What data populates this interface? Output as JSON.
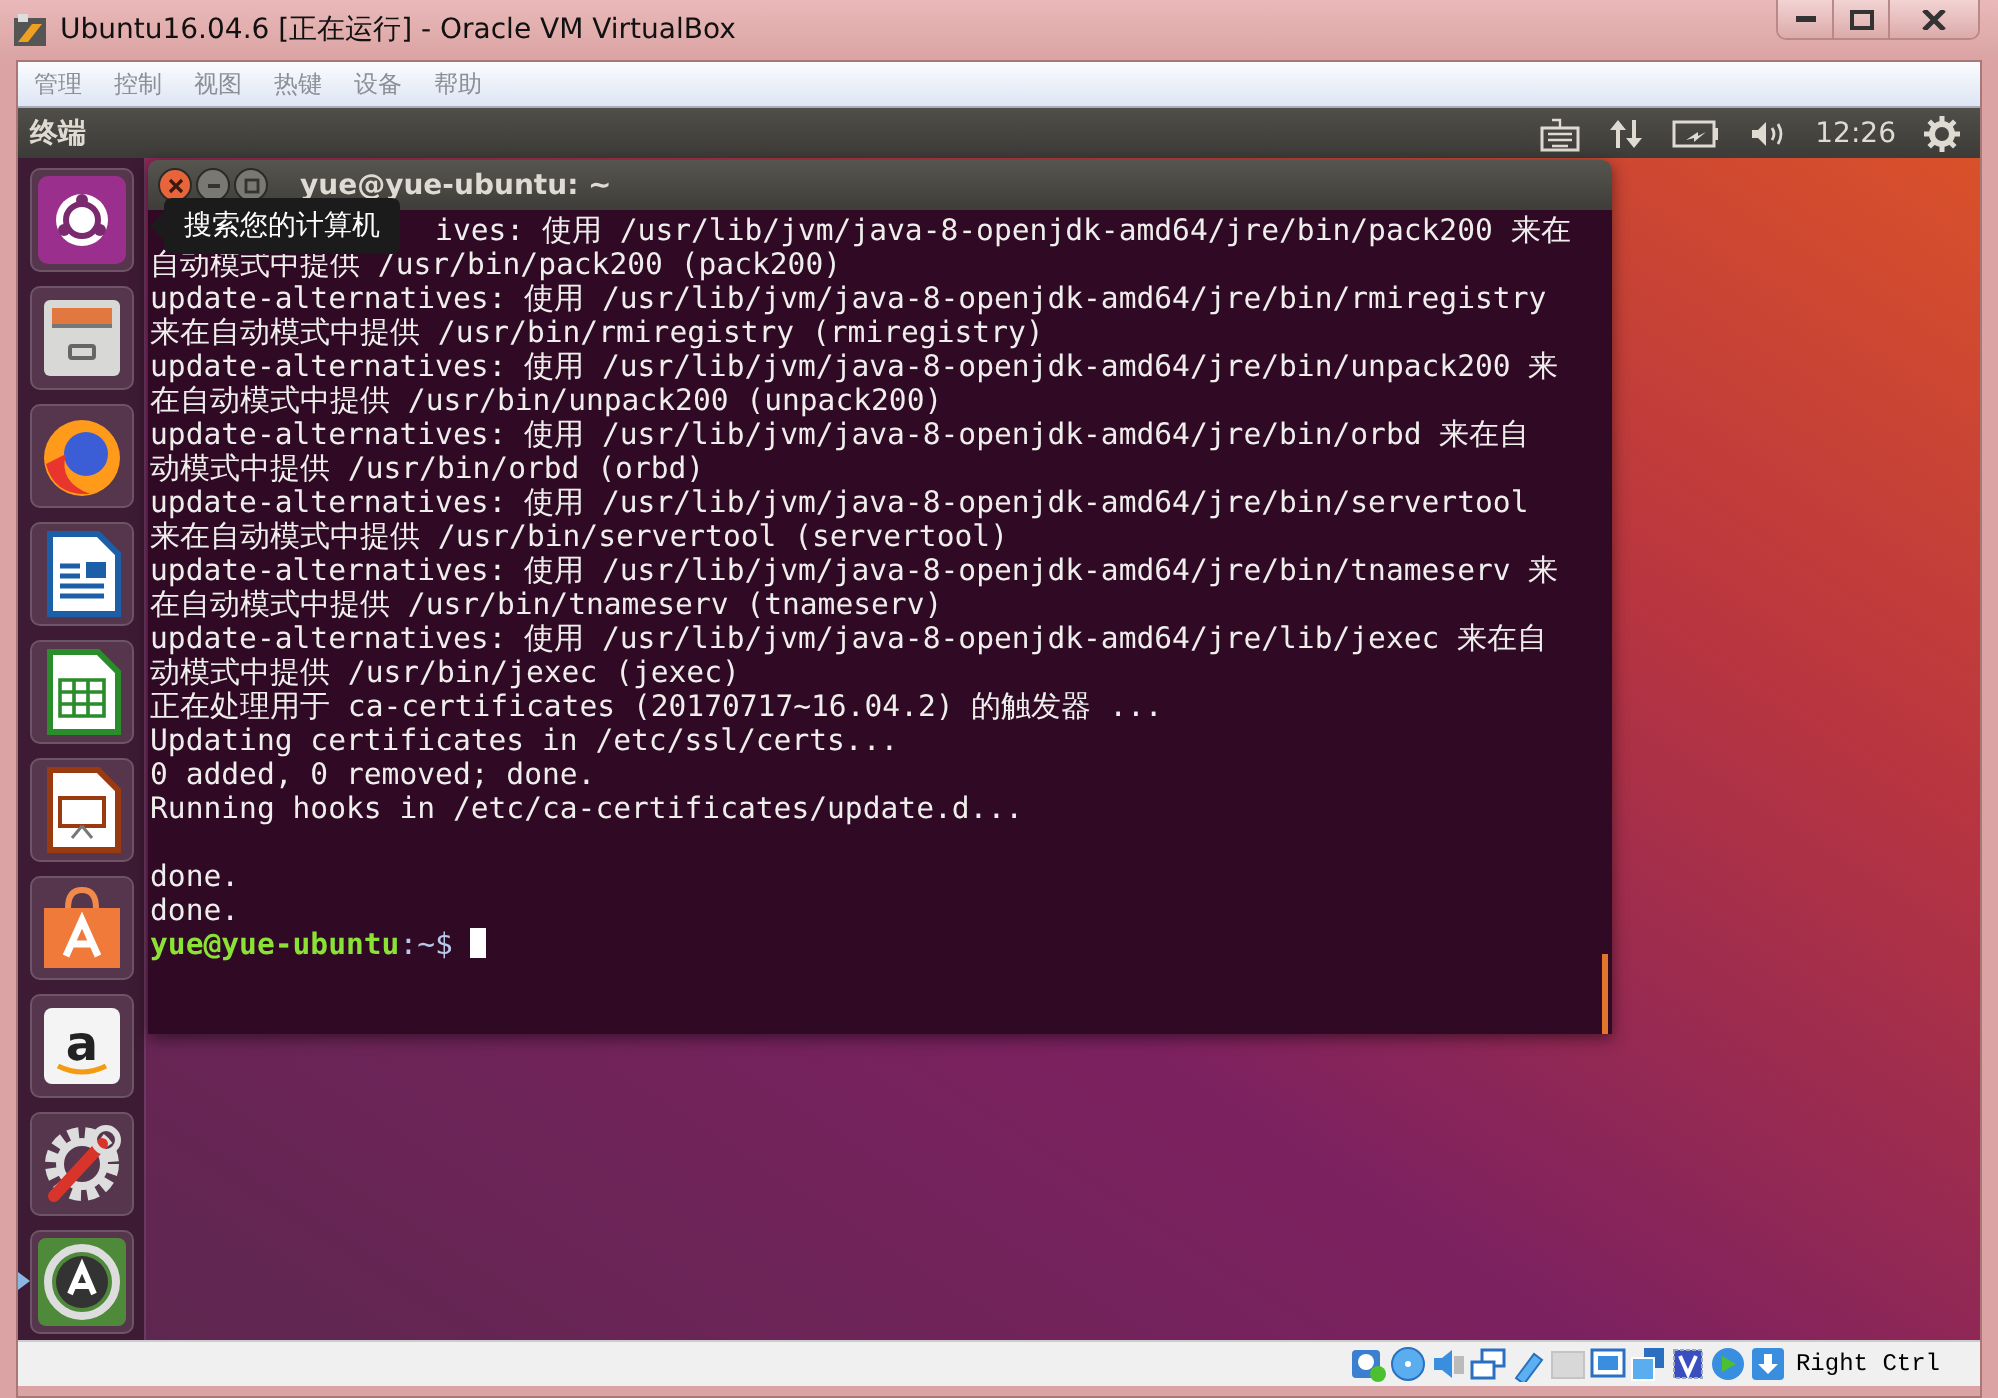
{
  "window": {
    "title": "Ubuntu16.04.6 [正在运行] - Oracle VM VirtualBox"
  },
  "menu": [
    "管理",
    "控制",
    "视图",
    "热键",
    "设备",
    "帮助"
  ],
  "panel": {
    "app_name": "终端",
    "clock": "12:26"
  },
  "launcher": {
    "items": [
      {
        "running": false
      },
      {
        "running": false
      },
      {
        "running": false
      },
      {
        "running": false
      },
      {
        "running": false
      },
      {
        "running": false
      },
      {
        "running": false
      },
      {
        "running": false,
        "glyph": "a"
      },
      {
        "running": false
      },
      {
        "running": true
      }
    ]
  },
  "tooltip": "搜索您的计算机",
  "terminal": {
    "title": "yue@yue-ubuntu: ~",
    "lines": [
      {
        "kind": "covered",
        "text": "ives: 使用 /usr/lib/jvm/java-8-openjdk-amd64/jre/bin/pack200 来在"
      },
      {
        "kind": "output",
        "text": "自动模式中提供 /usr/bin/pack200 (pack200)"
      },
      {
        "kind": "output",
        "text": "update-alternatives: 使用 /usr/lib/jvm/java-8-openjdk-amd64/jre/bin/rmiregistry"
      },
      {
        "kind": "output",
        "text": "来在自动模式中提供 /usr/bin/rmiregistry (rmiregistry)"
      },
      {
        "kind": "output",
        "text": "update-alternatives: 使用 /usr/lib/jvm/java-8-openjdk-amd64/jre/bin/unpack200 来"
      },
      {
        "kind": "output",
        "text": "在自动模式中提供 /usr/bin/unpack200 (unpack200)"
      },
      {
        "kind": "output",
        "text": "update-alternatives: 使用 /usr/lib/jvm/java-8-openjdk-amd64/jre/bin/orbd 来在自"
      },
      {
        "kind": "output",
        "text": "动模式中提供 /usr/bin/orbd (orbd)"
      },
      {
        "kind": "output",
        "text": "update-alternatives: 使用 /usr/lib/jvm/java-8-openjdk-amd64/jre/bin/servertool"
      },
      {
        "kind": "output",
        "text": "来在自动模式中提供 /usr/bin/servertool (servertool)"
      },
      {
        "kind": "output",
        "text": "update-alternatives: 使用 /usr/lib/jvm/java-8-openjdk-amd64/jre/bin/tnameserv 来"
      },
      {
        "kind": "output",
        "text": "在自动模式中提供 /usr/bin/tnameserv (tnameserv)"
      },
      {
        "kind": "output",
        "text": "update-alternatives: 使用 /usr/lib/jvm/java-8-openjdk-amd64/jre/lib/jexec 来在自"
      },
      {
        "kind": "output",
        "text": "动模式中提供 /usr/bin/jexec (jexec)"
      },
      {
        "kind": "output",
        "text": "正在处理用于 ca-certificates (20170717~16.04.2) 的触发器 ..."
      },
      {
        "kind": "output",
        "text": "Updating certificates in /etc/ssl/certs..."
      },
      {
        "kind": "output",
        "text": "0 added, 0 removed; done."
      },
      {
        "kind": "output",
        "text": "Running hooks in /etc/ca-certificates/update.d..."
      },
      {
        "kind": "blank"
      },
      {
        "kind": "output",
        "text": "done."
      },
      {
        "kind": "output",
        "text": "done."
      }
    ],
    "prompt": {
      "user_host": "yue@yue-ubuntu",
      "path": ":~$"
    }
  },
  "status_bar": {
    "host_key": "Right Ctrl"
  }
}
